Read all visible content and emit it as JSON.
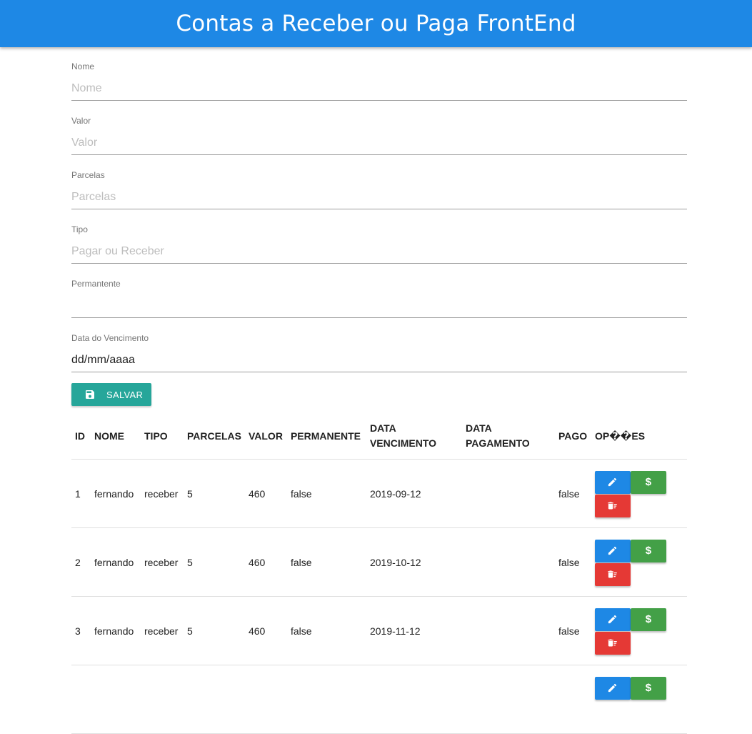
{
  "header": {
    "title": "Contas a Receber ou Paga FrontEnd"
  },
  "form": {
    "nome": {
      "label": "Nome",
      "placeholder": "Nome",
      "value": ""
    },
    "valor": {
      "label": "Valor",
      "placeholder": "Valor",
      "value": ""
    },
    "parcelas": {
      "label": "Parcelas",
      "placeholder": "Parcelas",
      "value": ""
    },
    "tipo": {
      "label": "Tipo",
      "placeholder": "Pagar ou Receber",
      "value": ""
    },
    "permanente": {
      "label": "Permantente",
      "placeholder": "",
      "value": ""
    },
    "data_vencimento": {
      "label": "Data do Vencimento",
      "value": "dd/mm/aaaa"
    },
    "save_label": "SALVAR",
    "save_icon": "floppy-disk-icon"
  },
  "table": {
    "headers": {
      "id": "ID",
      "nome": "NOME",
      "tipo": "TIPO",
      "parcelas": "PARCELAS",
      "valor": "VALOR",
      "permanente": "PERMANENTE",
      "data_vencimento": "DATA VENCIMENTO",
      "data_pagamento": "DATA PAGAMENTO",
      "pago": "PAGO",
      "opcoes": "OP��ES"
    },
    "rows": [
      {
        "id": "1",
        "nome": "fernando",
        "tipo": "receber",
        "parcelas": "5",
        "valor": "460",
        "permanente": "false",
        "data_vencimento": "2019-09-12",
        "data_pagamento": "",
        "pago": "false"
      },
      {
        "id": "2",
        "nome": "fernando",
        "tipo": "receber",
        "parcelas": "5",
        "valor": "460",
        "permanente": "false",
        "data_vencimento": "2019-10-12",
        "data_pagamento": "",
        "pago": "false"
      },
      {
        "id": "3",
        "nome": "fernando",
        "tipo": "receber",
        "parcelas": "5",
        "valor": "460",
        "permanente": "false",
        "data_vencimento": "2019-11-12",
        "data_pagamento": "",
        "pago": "false"
      }
    ],
    "row_buttons": {
      "edit_icon": "pencil-icon",
      "pay_label": "$",
      "delete_icon": "trash-icon"
    }
  },
  "colors": {
    "primary": "#1e88e5",
    "teal": "#26a69a",
    "green": "#43a047",
    "red": "#e53935"
  }
}
